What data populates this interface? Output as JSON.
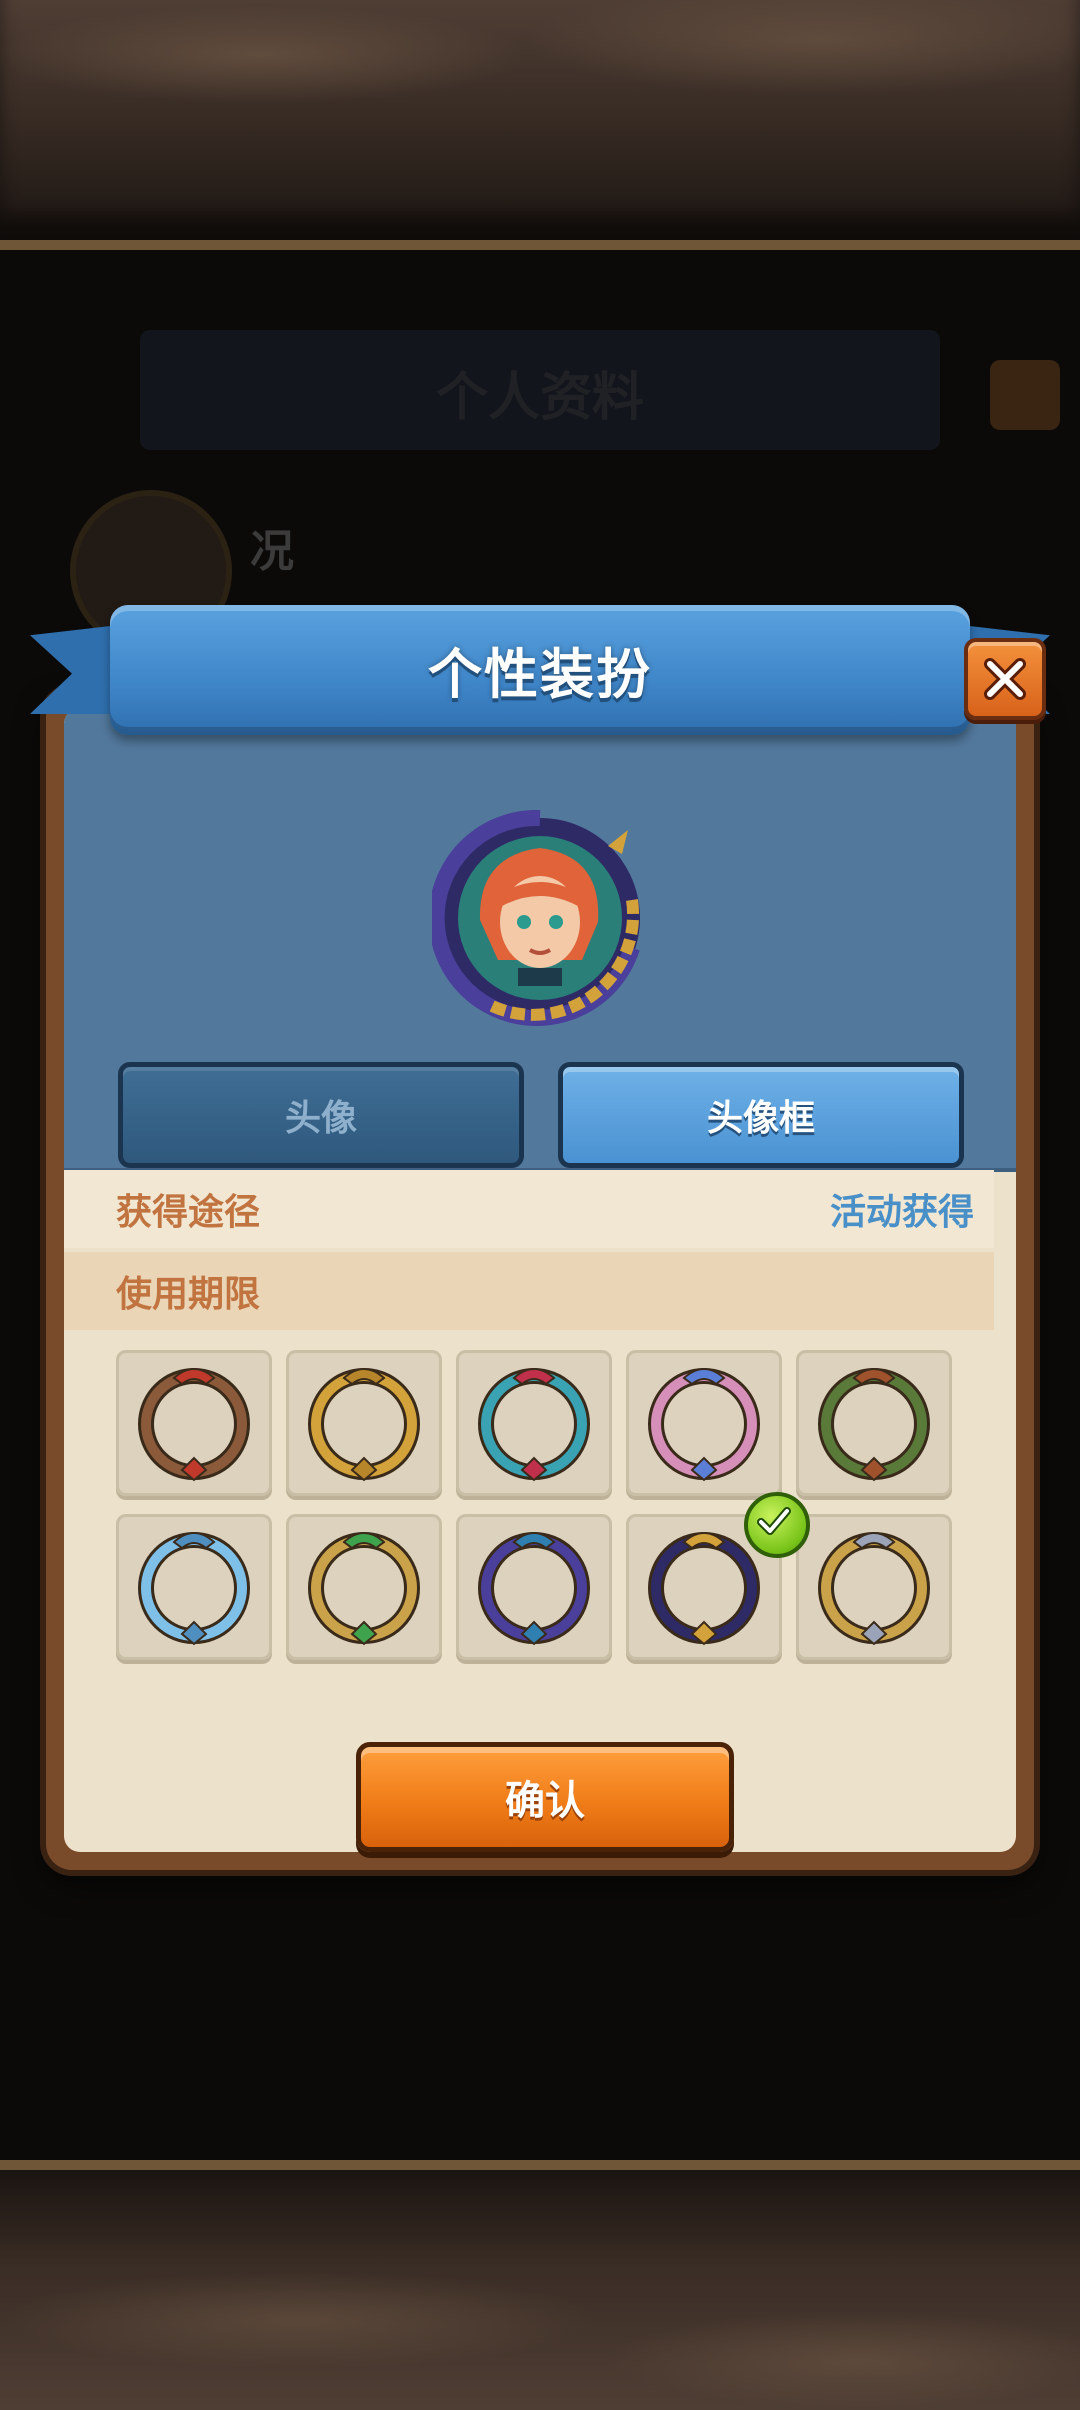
{
  "background": {
    "title": "个人资料",
    "player_name": "况"
  },
  "dialog": {
    "title": "个性装扮",
    "close_icon": "close-x-icon",
    "tabs": [
      {
        "label": "头像",
        "selected": false
      },
      {
        "label": "头像框",
        "selected": true
      }
    ],
    "info": {
      "source_label": "获得途径",
      "source_value": "活动获得",
      "period_label": "使用期限",
      "period_value": ""
    },
    "frames": [
      {
        "icon": "ornate-skull-frame-icon",
        "ring": "#8a5a3a",
        "accent": "#c0392b"
      },
      {
        "icon": "golden-frame-icon",
        "ring": "#d4a23a",
        "accent": "#b8862a"
      },
      {
        "icon": "rose-frame-icon",
        "ring": "#3aa3b3",
        "accent": "#c0304a"
      },
      {
        "icon": "pink-ribbon-frame-icon",
        "ring": "#d68fb8",
        "accent": "#5b7fd6"
      },
      {
        "icon": "winged-leaf-frame-icon",
        "ring": "#5a7a3a",
        "accent": "#a0522d"
      },
      {
        "icon": "ice-crystal-frame-icon",
        "ring": "#7fc0e8",
        "accent": "#4f8fc0"
      },
      {
        "icon": "gold-gem-frame-icon",
        "ring": "#c9a24a",
        "accent": "#3fa34d"
      },
      {
        "icon": "purple-serpent-frame-icon",
        "ring": "#4a3f9a",
        "accent": "#2f7fb0"
      },
      {
        "icon": "chain-serpent-frame-icon",
        "ring": "#2e2a66",
        "accent": "#d4a23a",
        "selected": true
      },
      {
        "icon": "silver-wing-frame-icon",
        "ring": "#c9a24a",
        "accent": "#9aa3b8"
      }
    ],
    "confirm_label": "确认",
    "colors": {
      "banner": "#3f86c9",
      "panel": "#52789c",
      "label": "#c1743f",
      "value": "#4a90c8",
      "confirm": "#f07d18"
    }
  }
}
